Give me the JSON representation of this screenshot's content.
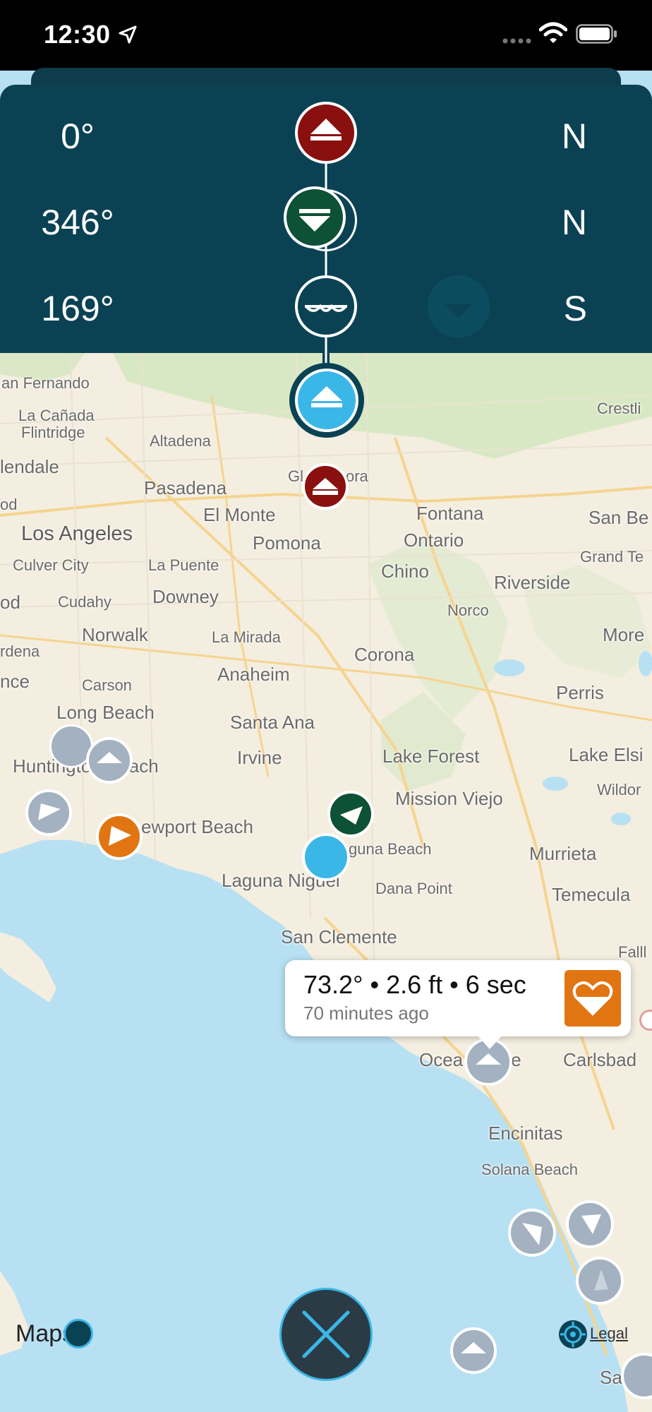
{
  "status_bar": {
    "time": "12:30"
  },
  "header_rows": [
    {
      "degrees": "0°",
      "direction": "N",
      "marker_color": "#8a1010",
      "marker": "arrow-up-icon"
    },
    {
      "degrees": "346°",
      "direction": "N",
      "marker_color": "#0d5136",
      "marker": "arrow-down-icon"
    },
    {
      "degrees": "169°",
      "direction": "S",
      "marker_color": "#0a4254",
      "marker": "wave-icon"
    }
  ],
  "map": {
    "labels": [
      {
        "text": "an Fernando",
        "cls": "sm"
      },
      {
        "text": "La Cañada",
        "cls": "sm"
      },
      {
        "text": "Flintridge",
        "cls": "sm"
      },
      {
        "text": "Altadena",
        "cls": "sm"
      },
      {
        "text": "Crestli",
        "cls": "sm"
      },
      {
        "text": "lendale",
        "cls": "mid"
      },
      {
        "text": "Pasadena",
        "cls": "mid"
      },
      {
        "text": "Gl",
        "cls": "sm"
      },
      {
        "text": "ora",
        "cls": "sm"
      },
      {
        "text": "od",
        "cls": "sm"
      },
      {
        "text": "El Monte",
        "cls": "mid"
      },
      {
        "text": "Fontana",
        "cls": "mid"
      },
      {
        "text": "San Be",
        "cls": "mid"
      },
      {
        "text": "Los Angeles",
        "cls": "big"
      },
      {
        "text": "Pomona",
        "cls": "mid"
      },
      {
        "text": "Ontario",
        "cls": "mid"
      },
      {
        "text": "Grand Te",
        "cls": "sm"
      },
      {
        "text": "Culver City",
        "cls": "sm"
      },
      {
        "text": "La Puente",
        "cls": "sm"
      },
      {
        "text": "Chino",
        "cls": "mid"
      },
      {
        "text": "Riverside",
        "cls": "mid"
      },
      {
        "text": "od",
        "cls": "mid"
      },
      {
        "text": "Cudahy",
        "cls": "sm"
      },
      {
        "text": "Downey",
        "cls": "mid"
      },
      {
        "text": "Norco",
        "cls": "sm"
      },
      {
        "text": "rdena",
        "cls": "sm"
      },
      {
        "text": "Norwalk",
        "cls": "mid"
      },
      {
        "text": "La Mirada",
        "cls": "sm"
      },
      {
        "text": "More",
        "cls": "mid"
      },
      {
        "text": "Corona",
        "cls": "mid"
      },
      {
        "text": "nce",
        "cls": "mid"
      },
      {
        "text": "Anaheim",
        "cls": "mid"
      },
      {
        "text": "Carson",
        "cls": "sm"
      },
      {
        "text": "Perris",
        "cls": "mid"
      },
      {
        "text": "Long Beach",
        "cls": "mid"
      },
      {
        "text": "Santa Ana",
        "cls": "mid"
      },
      {
        "text": "Irvine",
        "cls": "mid"
      },
      {
        "text": "Lake Forest",
        "cls": "mid"
      },
      {
        "text": "Lake Elsi",
        "cls": "mid"
      },
      {
        "text": "Huntington Beach",
        "cls": "mid"
      },
      {
        "text": "Mission Viejo",
        "cls": "mid"
      },
      {
        "text": "Wildor",
        "cls": "sm"
      },
      {
        "text": "ewport Beach",
        "cls": "mid"
      },
      {
        "text": "guna Beach",
        "cls": "sm"
      },
      {
        "text": "Murrieta",
        "cls": "mid"
      },
      {
        "text": "Laguna Niguel",
        "cls": "mid"
      },
      {
        "text": "Dana Point",
        "cls": "sm"
      },
      {
        "text": "Temecula",
        "cls": "mid"
      },
      {
        "text": "San Clemente",
        "cls": "mid"
      },
      {
        "text": "Falll",
        "cls": "sm"
      },
      {
        "text": "Ocea",
        "cls": "mid"
      },
      {
        "text": "ide",
        "cls": "mid"
      },
      {
        "text": "Carlsbad",
        "cls": "mid"
      },
      {
        "text": "Encinitas",
        "cls": "mid"
      },
      {
        "text": "Solana Beach",
        "cls": "sm"
      },
      {
        "text": "San D",
        "cls": "mid"
      }
    ]
  },
  "popup": {
    "main": "73.2° • 2.6 ft • 6 sec",
    "sub": "70 minutes ago",
    "icon": "heart-icon",
    "color": "#e07512"
  },
  "footer": {
    "maps_logo": "Maps",
    "legal": "Legal",
    "close_icon": "close-icon"
  },
  "colors": {
    "panel": "#0a4254",
    "active_blue": "#3bb7e7",
    "gray_marker": "#a3b1c0",
    "orange": "#e07512",
    "red": "#8a1010",
    "green": "#0d5136"
  }
}
